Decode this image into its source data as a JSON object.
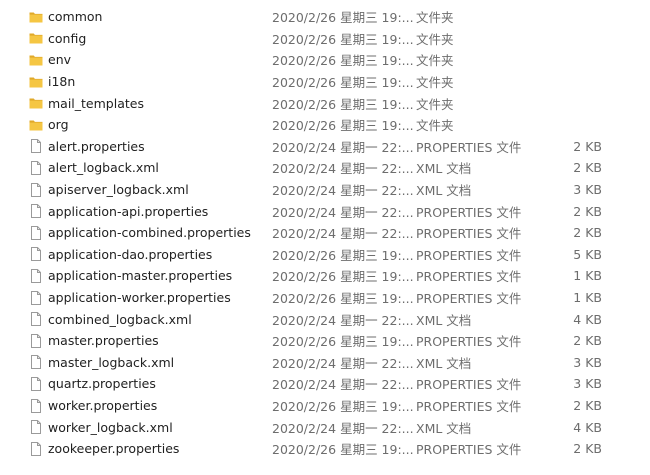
{
  "colors": {
    "folder": "#f5c643",
    "folder_dark": "#e0a92a",
    "file_border": "#9a9a9a",
    "text": "#1f1f1f",
    "muted": "#6d6d6d"
  },
  "files": [
    {
      "name": "common",
      "date": "2020/2/26 星期三 19:...",
      "type": "文件夹",
      "size": "",
      "icon": "folder-icon"
    },
    {
      "name": "config",
      "date": "2020/2/26 星期三 19:...",
      "type": "文件夹",
      "size": "",
      "icon": "folder-icon"
    },
    {
      "name": "env",
      "date": "2020/2/26 星期三 19:...",
      "type": "文件夹",
      "size": "",
      "icon": "folder-icon"
    },
    {
      "name": "i18n",
      "date": "2020/2/26 星期三 19:...",
      "type": "文件夹",
      "size": "",
      "icon": "folder-icon"
    },
    {
      "name": "mail_templates",
      "date": "2020/2/26 星期三 19:...",
      "type": "文件夹",
      "size": "",
      "icon": "folder-icon"
    },
    {
      "name": "org",
      "date": "2020/2/26 星期三 19:...",
      "type": "文件夹",
      "size": "",
      "icon": "folder-icon"
    },
    {
      "name": "alert.properties",
      "date": "2020/2/24 星期一 22:...",
      "type": "PROPERTIES 文件",
      "size": "2 KB",
      "icon": "file-icon"
    },
    {
      "name": "alert_logback.xml",
      "date": "2020/2/24 星期一 22:...",
      "type": "XML 文档",
      "size": "2 KB",
      "icon": "file-icon"
    },
    {
      "name": "apiserver_logback.xml",
      "date": "2020/2/24 星期一 22:...",
      "type": "XML 文档",
      "size": "3 KB",
      "icon": "file-icon"
    },
    {
      "name": "application-api.properties",
      "date": "2020/2/24 星期一 22:...",
      "type": "PROPERTIES 文件",
      "size": "2 KB",
      "icon": "file-icon"
    },
    {
      "name": "application-combined.properties",
      "date": "2020/2/24 星期一 22:...",
      "type": "PROPERTIES 文件",
      "size": "2 KB",
      "icon": "file-icon"
    },
    {
      "name": "application-dao.properties",
      "date": "2020/2/26 星期三 19:...",
      "type": "PROPERTIES 文件",
      "size": "5 KB",
      "icon": "file-icon"
    },
    {
      "name": "application-master.properties",
      "date": "2020/2/26 星期三 19:...",
      "type": "PROPERTIES 文件",
      "size": "1 KB",
      "icon": "file-icon"
    },
    {
      "name": "application-worker.properties",
      "date": "2020/2/26 星期三 19:...",
      "type": "PROPERTIES 文件",
      "size": "1 KB",
      "icon": "file-icon"
    },
    {
      "name": "combined_logback.xml",
      "date": "2020/2/24 星期一 22:...",
      "type": "XML 文档",
      "size": "4 KB",
      "icon": "file-icon"
    },
    {
      "name": "master.properties",
      "date": "2020/2/26 星期三 19:...",
      "type": "PROPERTIES 文件",
      "size": "2 KB",
      "icon": "file-icon"
    },
    {
      "name": "master_logback.xml",
      "date": "2020/2/24 星期一 22:...",
      "type": "XML 文档",
      "size": "3 KB",
      "icon": "file-icon"
    },
    {
      "name": "quartz.properties",
      "date": "2020/2/24 星期一 22:...",
      "type": "PROPERTIES 文件",
      "size": "3 KB",
      "icon": "file-icon"
    },
    {
      "name": "worker.properties",
      "date": "2020/2/26 星期三 19:...",
      "type": "PROPERTIES 文件",
      "size": "2 KB",
      "icon": "file-icon"
    },
    {
      "name": "worker_logback.xml",
      "date": "2020/2/24 星期一 22:...",
      "type": "XML 文档",
      "size": "4 KB",
      "icon": "file-icon"
    },
    {
      "name": "zookeeper.properties",
      "date": "2020/2/26 星期三 19:...",
      "type": "PROPERTIES 文件",
      "size": "2 KB",
      "icon": "file-icon"
    }
  ]
}
